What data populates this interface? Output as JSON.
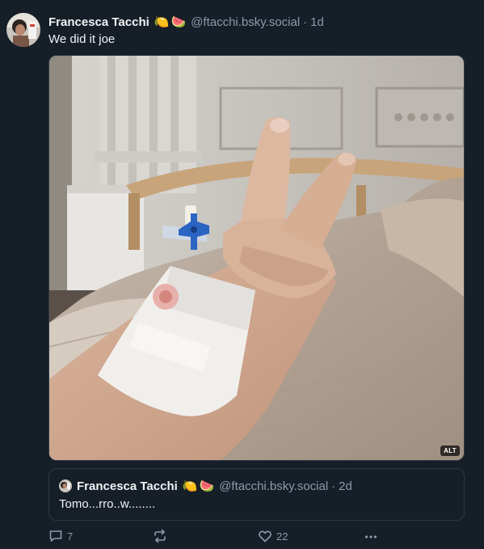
{
  "post": {
    "author_name": "Francesca Tacchi",
    "author_emoji": [
      "🍋",
      "🍉"
    ],
    "handle": "@ftacchi.bsky.social",
    "separator": "·",
    "time": "1d",
    "text": "We did it joe",
    "image": {
      "alt_badge": "ALT"
    }
  },
  "quote": {
    "author_name": "Francesca Tacchi",
    "author_emoji": [
      "🍋",
      "🍉"
    ],
    "handle": "@ftacchi.bsky.social",
    "separator": "·",
    "time": "2d",
    "text": "Tomo...rro..w........"
  },
  "actions": {
    "reply_count": "7",
    "repost_count": "",
    "like_count": "22"
  },
  "colors": {
    "background": "#161e27",
    "muted_text": "#8d9aab",
    "border": "#2e3a48"
  },
  "icons": [
    "reply-icon",
    "repost-icon",
    "like-icon",
    "more-icon"
  ]
}
